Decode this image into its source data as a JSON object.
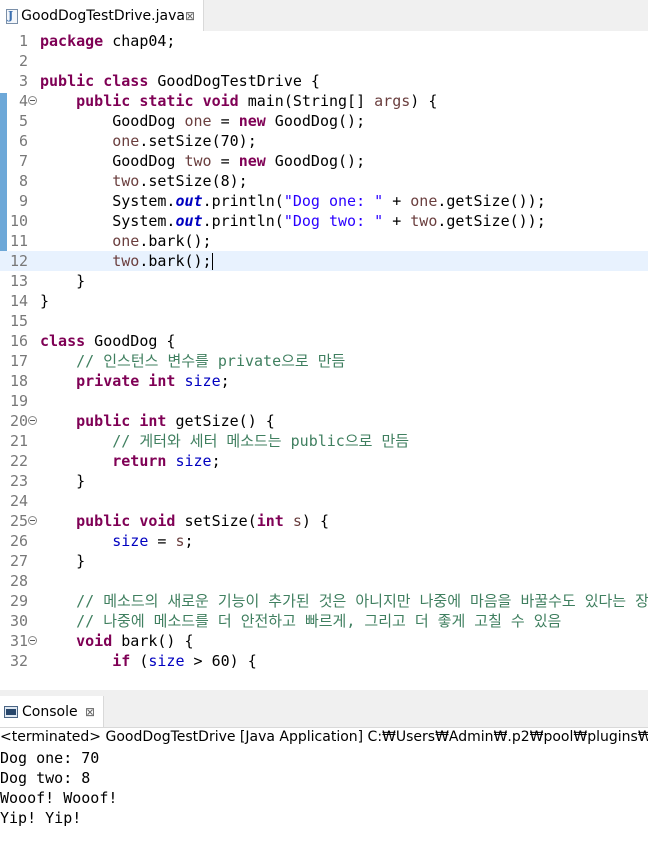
{
  "editor": {
    "tab": {
      "title": "GoodDogTestDrive.java",
      "close": "⊠"
    },
    "current_line": 12,
    "folded_lines": [
      4,
      20,
      25,
      31
    ],
    "lines": [
      {
        "n": "1",
        "tokens": [
          [
            "kw",
            "package"
          ],
          [
            "t",
            " chap04;"
          ]
        ]
      },
      {
        "n": "2",
        "tokens": []
      },
      {
        "n": "3",
        "tokens": [
          [
            "kw",
            "public"
          ],
          [
            "t",
            " "
          ],
          [
            "kw",
            "class"
          ],
          [
            "t",
            " GoodDogTestDrive {"
          ]
        ]
      },
      {
        "n": "4",
        "tokens": [
          [
            "t",
            "    "
          ],
          [
            "kw",
            "public"
          ],
          [
            "t",
            " "
          ],
          [
            "kw",
            "static"
          ],
          [
            "t",
            " "
          ],
          [
            "kw",
            "void"
          ],
          [
            "t",
            " main(String[] "
          ],
          [
            "var",
            "args"
          ],
          [
            "t",
            ") {"
          ]
        ]
      },
      {
        "n": "5",
        "tokens": [
          [
            "t",
            "        GoodDog "
          ],
          [
            "var",
            "one"
          ],
          [
            "t",
            " = "
          ],
          [
            "kw",
            "new"
          ],
          [
            "t",
            " GoodDog();"
          ]
        ]
      },
      {
        "n": "6",
        "tokens": [
          [
            "t",
            "        "
          ],
          [
            "var",
            "one"
          ],
          [
            "t",
            ".setSize(70);"
          ]
        ]
      },
      {
        "n": "7",
        "tokens": [
          [
            "t",
            "        GoodDog "
          ],
          [
            "var",
            "two"
          ],
          [
            "t",
            " = "
          ],
          [
            "kw",
            "new"
          ],
          [
            "t",
            " GoodDog();"
          ]
        ]
      },
      {
        "n": "8",
        "tokens": [
          [
            "t",
            "        "
          ],
          [
            "var",
            "two"
          ],
          [
            "t",
            ".setSize(8);"
          ]
        ]
      },
      {
        "n": "9",
        "tokens": [
          [
            "t",
            "        System."
          ],
          [
            "sfld",
            "out"
          ],
          [
            "t",
            ".println("
          ],
          [
            "str",
            "\"Dog one: \""
          ],
          [
            "t",
            " + "
          ],
          [
            "var",
            "one"
          ],
          [
            "t",
            ".getSize());"
          ]
        ]
      },
      {
        "n": "10",
        "tokens": [
          [
            "t",
            "        System."
          ],
          [
            "sfld",
            "out"
          ],
          [
            "t",
            ".println("
          ],
          [
            "str",
            "\"Dog two: \""
          ],
          [
            "t",
            " + "
          ],
          [
            "var",
            "two"
          ],
          [
            "t",
            ".getSize());"
          ]
        ]
      },
      {
        "n": "11",
        "tokens": [
          [
            "t",
            "        "
          ],
          [
            "var",
            "one"
          ],
          [
            "t",
            ".bark();"
          ]
        ]
      },
      {
        "n": "12",
        "tokens": [
          [
            "t",
            "        "
          ],
          [
            "var",
            "two"
          ],
          [
            "t",
            ".bark();"
          ],
          [
            "caret",
            ""
          ]
        ]
      },
      {
        "n": "13",
        "tokens": [
          [
            "t",
            "    }"
          ]
        ]
      },
      {
        "n": "14",
        "tokens": [
          [
            "t",
            "}"
          ]
        ]
      },
      {
        "n": "15",
        "tokens": []
      },
      {
        "n": "16",
        "tokens": [
          [
            "kw",
            "class"
          ],
          [
            "t",
            " GoodDog {"
          ]
        ]
      },
      {
        "n": "17",
        "tokens": [
          [
            "t",
            "    "
          ],
          [
            "cmt",
            "// 인스턴스 변수를 private으로 만듬"
          ]
        ]
      },
      {
        "n": "18",
        "tokens": [
          [
            "t",
            "    "
          ],
          [
            "kw",
            "private"
          ],
          [
            "t",
            " "
          ],
          [
            "kw",
            "int"
          ],
          [
            "t",
            " "
          ],
          [
            "fld",
            "size"
          ],
          [
            "t",
            ";"
          ]
        ]
      },
      {
        "n": "19",
        "tokens": []
      },
      {
        "n": "20",
        "tokens": [
          [
            "t",
            "    "
          ],
          [
            "kw",
            "public"
          ],
          [
            "t",
            " "
          ],
          [
            "kw",
            "int"
          ],
          [
            "t",
            " getSize() {"
          ]
        ]
      },
      {
        "n": "21",
        "tokens": [
          [
            "t",
            "        "
          ],
          [
            "cmt",
            "// 게터와 세터 메소드는 public으로 만듬"
          ]
        ]
      },
      {
        "n": "22",
        "tokens": [
          [
            "t",
            "        "
          ],
          [
            "kw",
            "return"
          ],
          [
            "t",
            " "
          ],
          [
            "fld",
            "size"
          ],
          [
            "t",
            ";"
          ]
        ]
      },
      {
        "n": "23",
        "tokens": [
          [
            "t",
            "    }"
          ]
        ]
      },
      {
        "n": "24",
        "tokens": []
      },
      {
        "n": "25",
        "tokens": [
          [
            "t",
            "    "
          ],
          [
            "kw",
            "public"
          ],
          [
            "t",
            " "
          ],
          [
            "kw",
            "void"
          ],
          [
            "t",
            " setSize("
          ],
          [
            "kw",
            "int"
          ],
          [
            "t",
            " "
          ],
          [
            "var",
            "s"
          ],
          [
            "t",
            ") {"
          ]
        ]
      },
      {
        "n": "26",
        "tokens": [
          [
            "t",
            "        "
          ],
          [
            "fld",
            "size"
          ],
          [
            "t",
            " = "
          ],
          [
            "var",
            "s"
          ],
          [
            "t",
            ";"
          ]
        ]
      },
      {
        "n": "27",
        "tokens": [
          [
            "t",
            "    }"
          ]
        ]
      },
      {
        "n": "28",
        "tokens": []
      },
      {
        "n": "29",
        "tokens": [
          [
            "t",
            "    "
          ],
          [
            "cmt",
            "// 메소드의 새로운 기능이 추가된 것은 아니지만 나중에 마음을 바꿀수도 있다는 장점 존재"
          ]
        ]
      },
      {
        "n": "30",
        "tokens": [
          [
            "t",
            "    "
          ],
          [
            "cmt",
            "// 나중에 메소드를 더 안전하고 빠르게, 그리고 더 좋게 고칠 수 있음"
          ]
        ]
      },
      {
        "n": "31",
        "tokens": [
          [
            "t",
            "    "
          ],
          [
            "kw",
            "void"
          ],
          [
            "t",
            " bark() {"
          ]
        ]
      },
      {
        "n": "32",
        "tokens": [
          [
            "t",
            "        "
          ],
          [
            "kw",
            "if"
          ],
          [
            "t",
            " ("
          ],
          [
            "fld",
            "size"
          ],
          [
            "t",
            " > 60) {"
          ]
        ]
      }
    ],
    "scroll_left_arrow": "<"
  },
  "console": {
    "tab": {
      "title": "Console",
      "close": "⊠"
    },
    "status": "<terminated> GoodDogTestDrive [Java Application] C:₩Users₩Admin₩.p2₩pool₩plugins₩org.e",
    "output": [
      "Dog one: 70",
      "Dog two: 8",
      "Wooof! Wooof!",
      "Yip! Yip!"
    ]
  },
  "colors": {
    "keyword": "#7f0055",
    "local_variable": "#6a3e3e",
    "string": "#2a00ff",
    "field": "#0000c0",
    "comment": "#3f7f5f",
    "current_line_bg": "#e8f2fe",
    "change_ruler": "#6da8d8"
  }
}
